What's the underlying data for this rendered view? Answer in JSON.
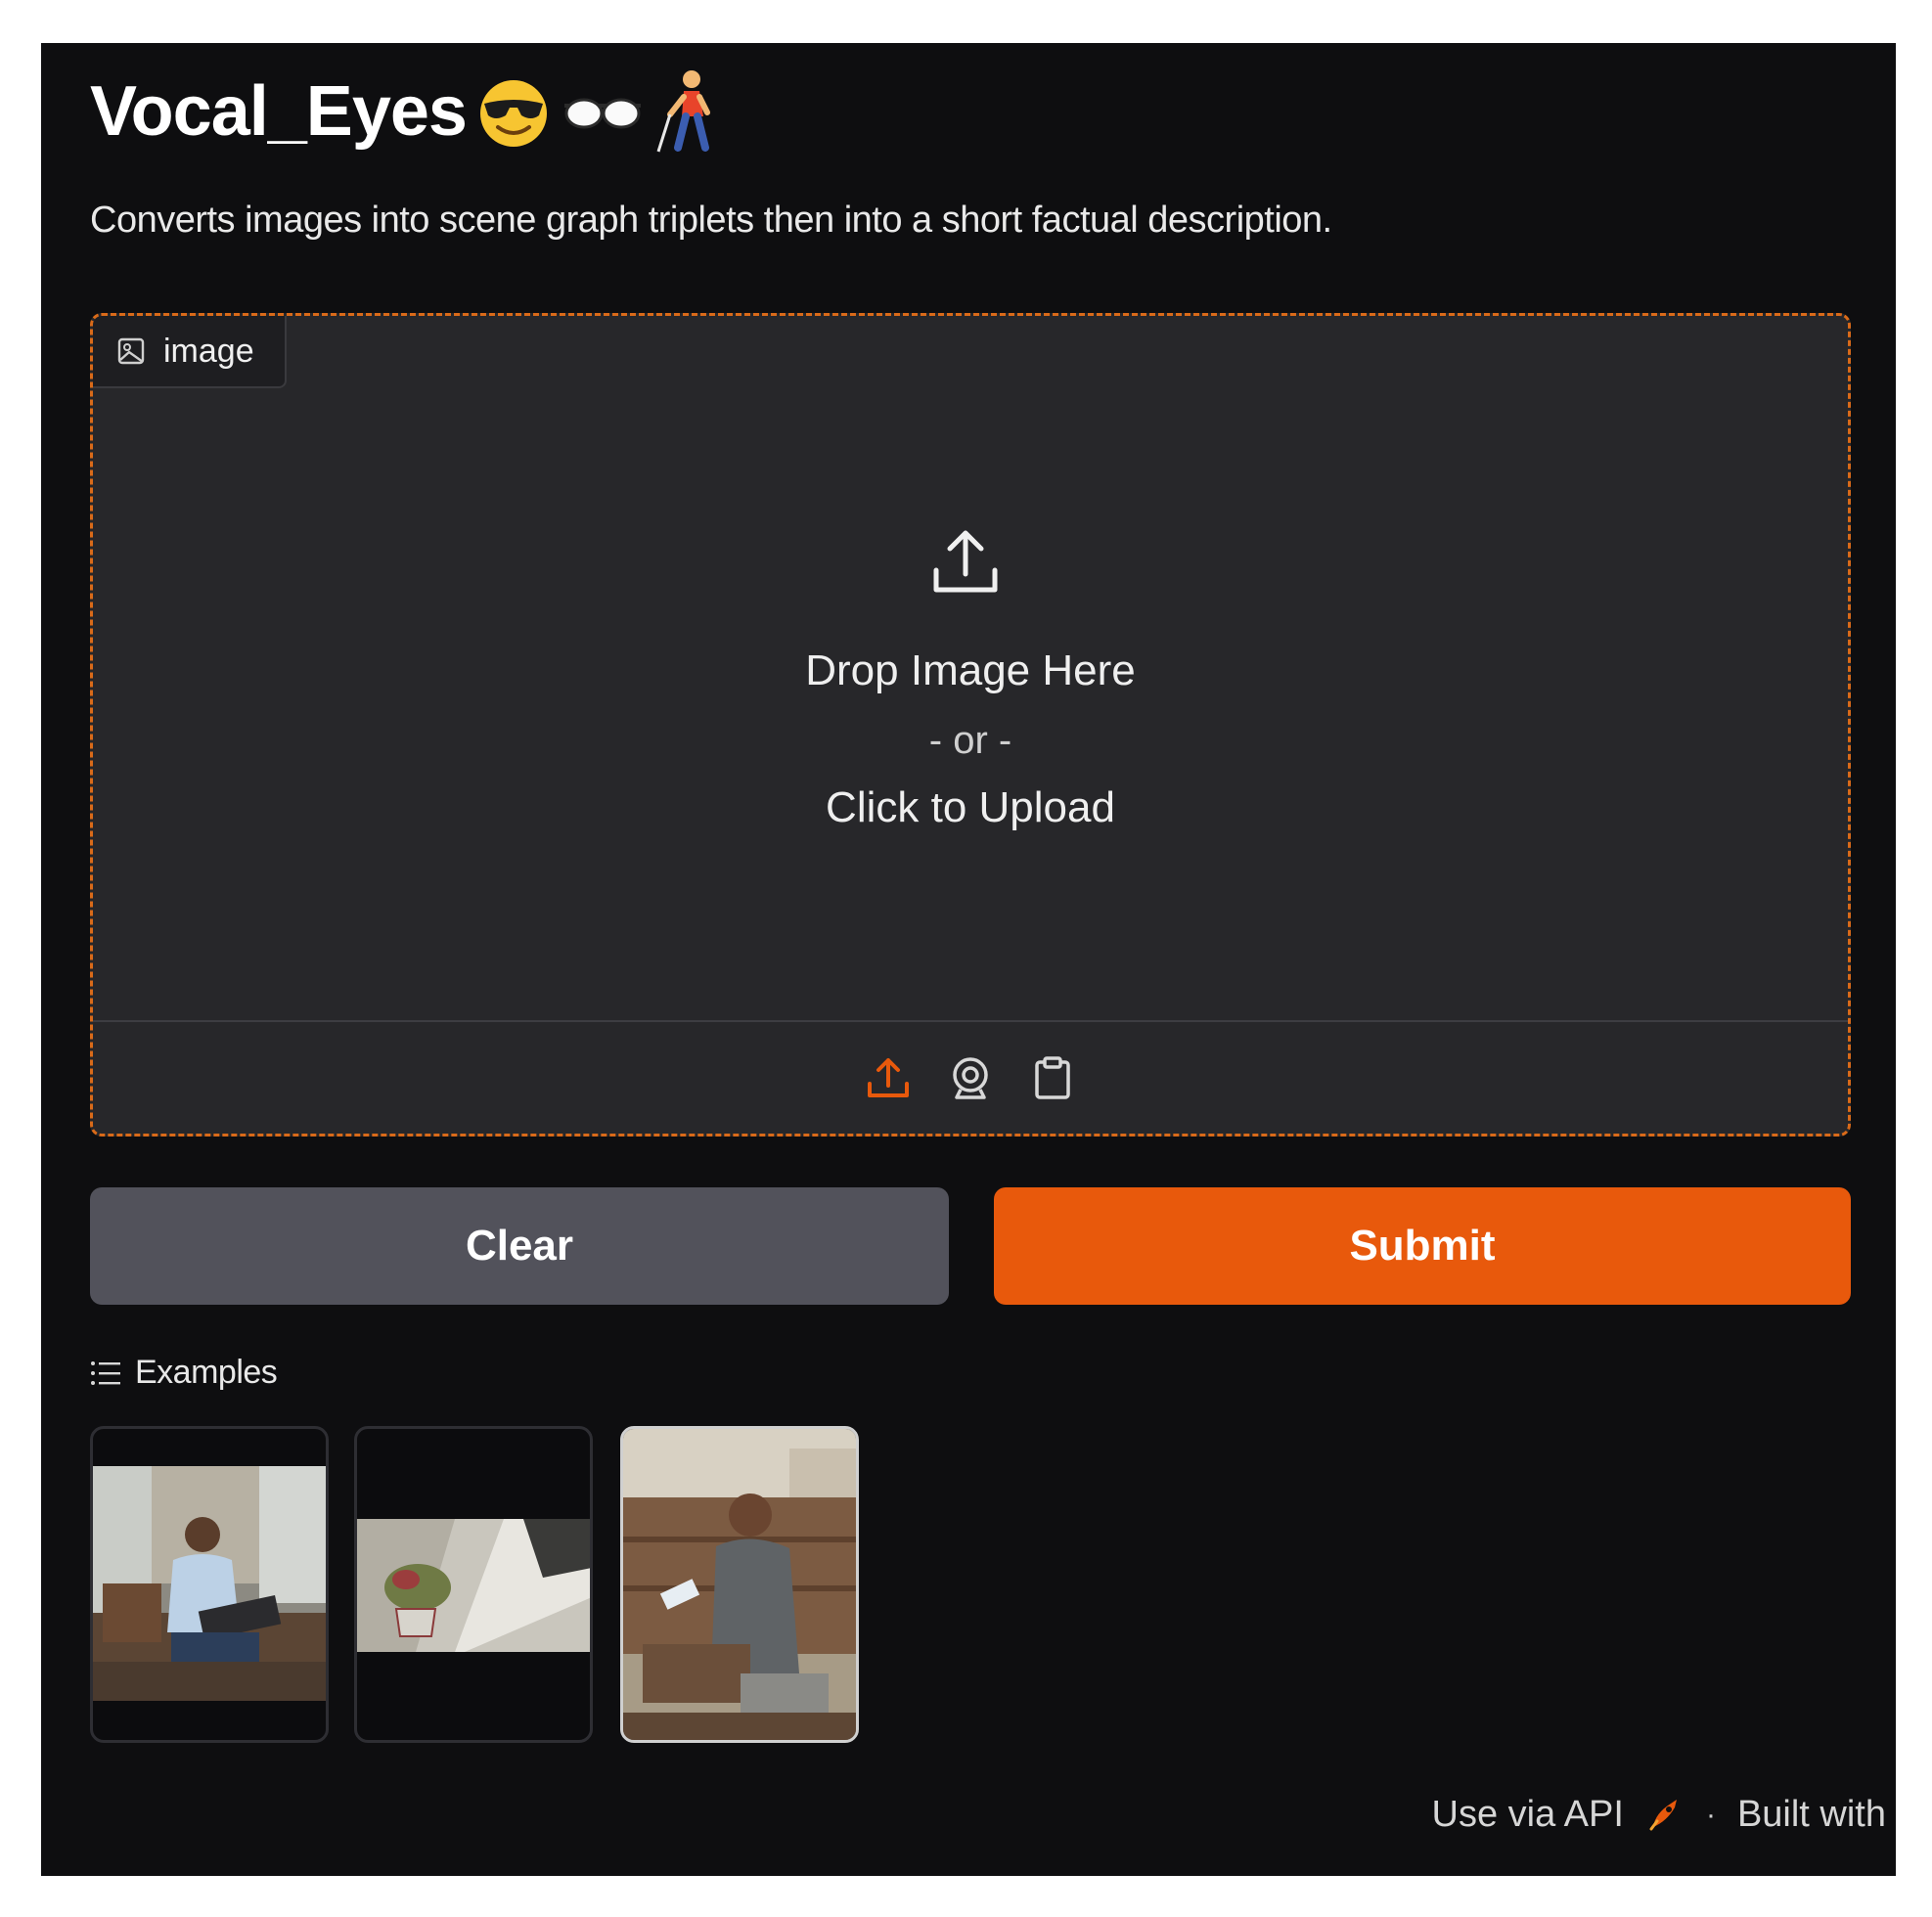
{
  "app": {
    "title": "Vocal_Eyes",
    "title_emojis": [
      "smiling-face-with-sunglasses-icon",
      "glasses-icon",
      "person-with-white-cane-icon"
    ],
    "description": "Converts images into scene graph triplets then into a short factual description."
  },
  "image_input": {
    "label": "image",
    "drop_text": "Drop Image Here",
    "or_text": "- or -",
    "click_text": "Click to Upload",
    "sources": [
      "upload-icon",
      "webcam-icon",
      "clipboard-icon"
    ],
    "active_source": "upload-icon"
  },
  "buttons": {
    "clear": "Clear",
    "submit": "Submit"
  },
  "examples": {
    "label": "Examples",
    "items": [
      {
        "name": "example-1"
      },
      {
        "name": "example-2"
      },
      {
        "name": "example-3"
      }
    ]
  },
  "footer": {
    "api_link": "Use via API",
    "separator": "·",
    "built_with": "Built with"
  },
  "colors": {
    "accent": "#e8590c",
    "background": "#0e0e10",
    "panel": "#27272a",
    "secondary_button": "#52525b"
  }
}
